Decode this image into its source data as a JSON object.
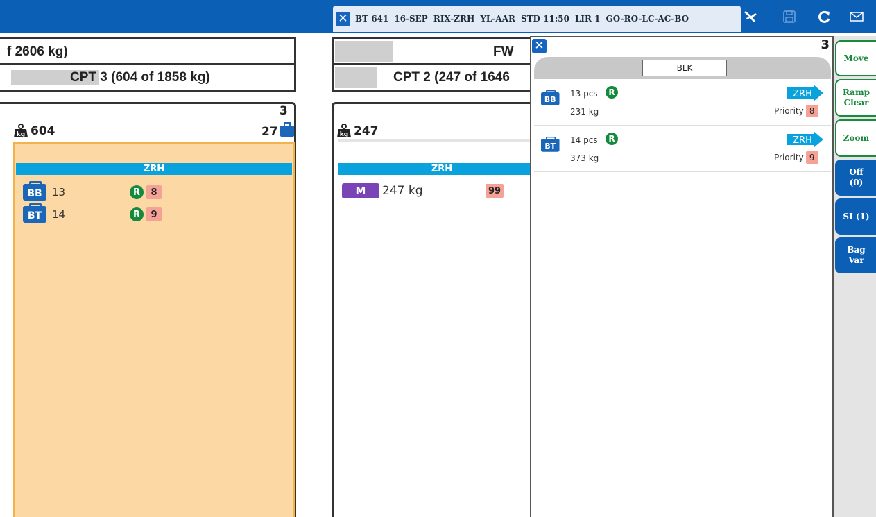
{
  "header": {
    "flight_segments": [
      "BT 641",
      "16-SEP",
      "RIX-ZRH",
      "YL-AAR",
      "STD 11:50",
      "LIR 1",
      "GO-RO-LC-AC-BO"
    ],
    "icons": [
      "airplane-depart-icon",
      "save-icon",
      "refresh-icon",
      "mail-icon"
    ]
  },
  "left_panel": {
    "hold_title": "f 2606 kg)",
    "compartment_title": "CPT 3 (604 of 1858 kg)",
    "card": {
      "weight": "604",
      "uld_count": "3",
      "bag_count": "27",
      "destination": "ZRH",
      "items": [
        {
          "type": "BB",
          "count": "13",
          "rush": "R",
          "priority": "8"
        },
        {
          "type": "BT",
          "count": "14",
          "rush": "R",
          "priority": "9"
        }
      ]
    }
  },
  "middle_panel": {
    "hold_title": "FW",
    "compartment_title": "CPT 2 (247 of 1646",
    "card": {
      "weight": "247",
      "destination": "ZRH",
      "items": [
        {
          "type": "M",
          "weight": "247 kg",
          "priority": "99"
        }
      ]
    }
  },
  "detail_panel": {
    "count": "3",
    "uld_label": "BLK",
    "rows": [
      {
        "type": "BB",
        "pieces": "13 pcs",
        "rush": "R",
        "weight": "231 kg",
        "destination": "ZRH",
        "priority_label": "Priority",
        "priority": "8"
      },
      {
        "type": "BT",
        "pieces": "14 pcs",
        "rush": "R",
        "weight": "373 kg",
        "destination": "ZRH",
        "priority_label": "Priority",
        "priority": "9"
      }
    ]
  },
  "actions": {
    "move": "Move",
    "ramp_clear": "Ramp Clear",
    "zoom": "Zoom",
    "offload": "Off (0)",
    "special_info": "SI (1)",
    "bag_var": "Bag Var"
  },
  "colors": {
    "header_blue": "#0b5fb5",
    "uld_fill": "#fcd8a4",
    "uld_border": "#f2b24e",
    "destination_band": "#0aa2dc",
    "bag_badge": "#1a66b8",
    "mail_badge": "#7a44b6",
    "rush_badge": "#138a3c",
    "priority_badge": "#f6a196",
    "action_green": "#1a8a3c"
  }
}
